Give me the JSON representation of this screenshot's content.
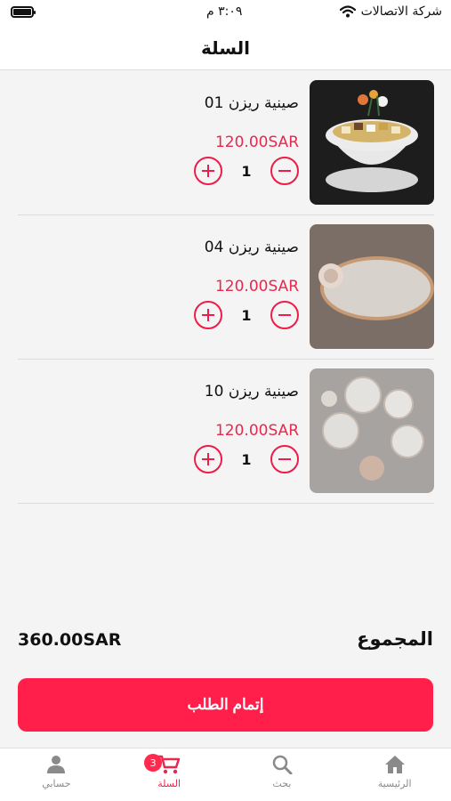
{
  "status_bar": {
    "carrier": "شركة الاتصالات",
    "time": "٣:٠٩ م"
  },
  "header": {
    "title": "السلة"
  },
  "cart_items": [
    {
      "name": "صينية ريزن 01",
      "price": "120.00SAR",
      "quantity": "1"
    },
    {
      "name": "صينية ريزن 04",
      "price": "120.00SAR",
      "quantity": "1"
    },
    {
      "name": "صينية ريزن 10",
      "price": "120.00SAR",
      "quantity": "1"
    }
  ],
  "summary": {
    "total_label": "المجموع",
    "total_value": "360.00SAR"
  },
  "checkout_button": "إتمام الطلب",
  "tabbar": {
    "home": "الرئيسية",
    "search": "بحث",
    "cart": "السلة",
    "cart_badge": "3",
    "account": "حسابي"
  },
  "colors": {
    "accent": "#ff1f4a",
    "price": "#e8284e",
    "tab_inactive": "#8a8a8a"
  }
}
